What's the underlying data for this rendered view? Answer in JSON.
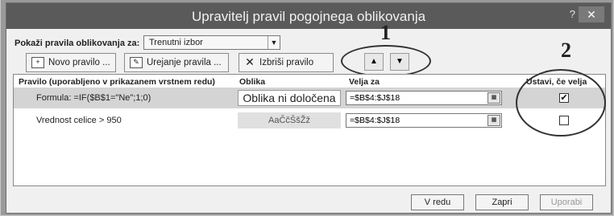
{
  "dialog": {
    "title": "Upravitelj pravil pogojnega oblikovanja",
    "help_label": "?",
    "close_label": "✕"
  },
  "show_rules": {
    "label": "Pokaži pravila oblikovanja za:",
    "value": "Trenutni izbor"
  },
  "toolbar": {
    "new_rule": "Novo pravilo ...",
    "edit_rule": "Urejanje pravila ...",
    "delete_rule": "Izbriši pravilo",
    "move_up": "▲",
    "move_down": "▼"
  },
  "annotations": {
    "one": "1",
    "two": "2"
  },
  "table": {
    "headers": {
      "rule": "Pravilo (uporabljeno v prikazanem vrstnem redu)",
      "format": "Oblika",
      "applies": "Velja za",
      "stop": "Ustavi, če velja"
    },
    "rows": [
      {
        "rule": "Formula: =IF($B$1=\"Ne\";1;0)",
        "format": "Oblika ni določena",
        "applies": "=$B$4:$J$18",
        "stop": "✔"
      },
      {
        "rule": "Vrednost celice > 950",
        "format": "AaČčŠšŽž",
        "applies": "=$B$4:$J$18",
        "stop": ""
      }
    ]
  },
  "footer": {
    "ok": "V redu",
    "close": "Zapri",
    "apply": "Uporabi"
  }
}
